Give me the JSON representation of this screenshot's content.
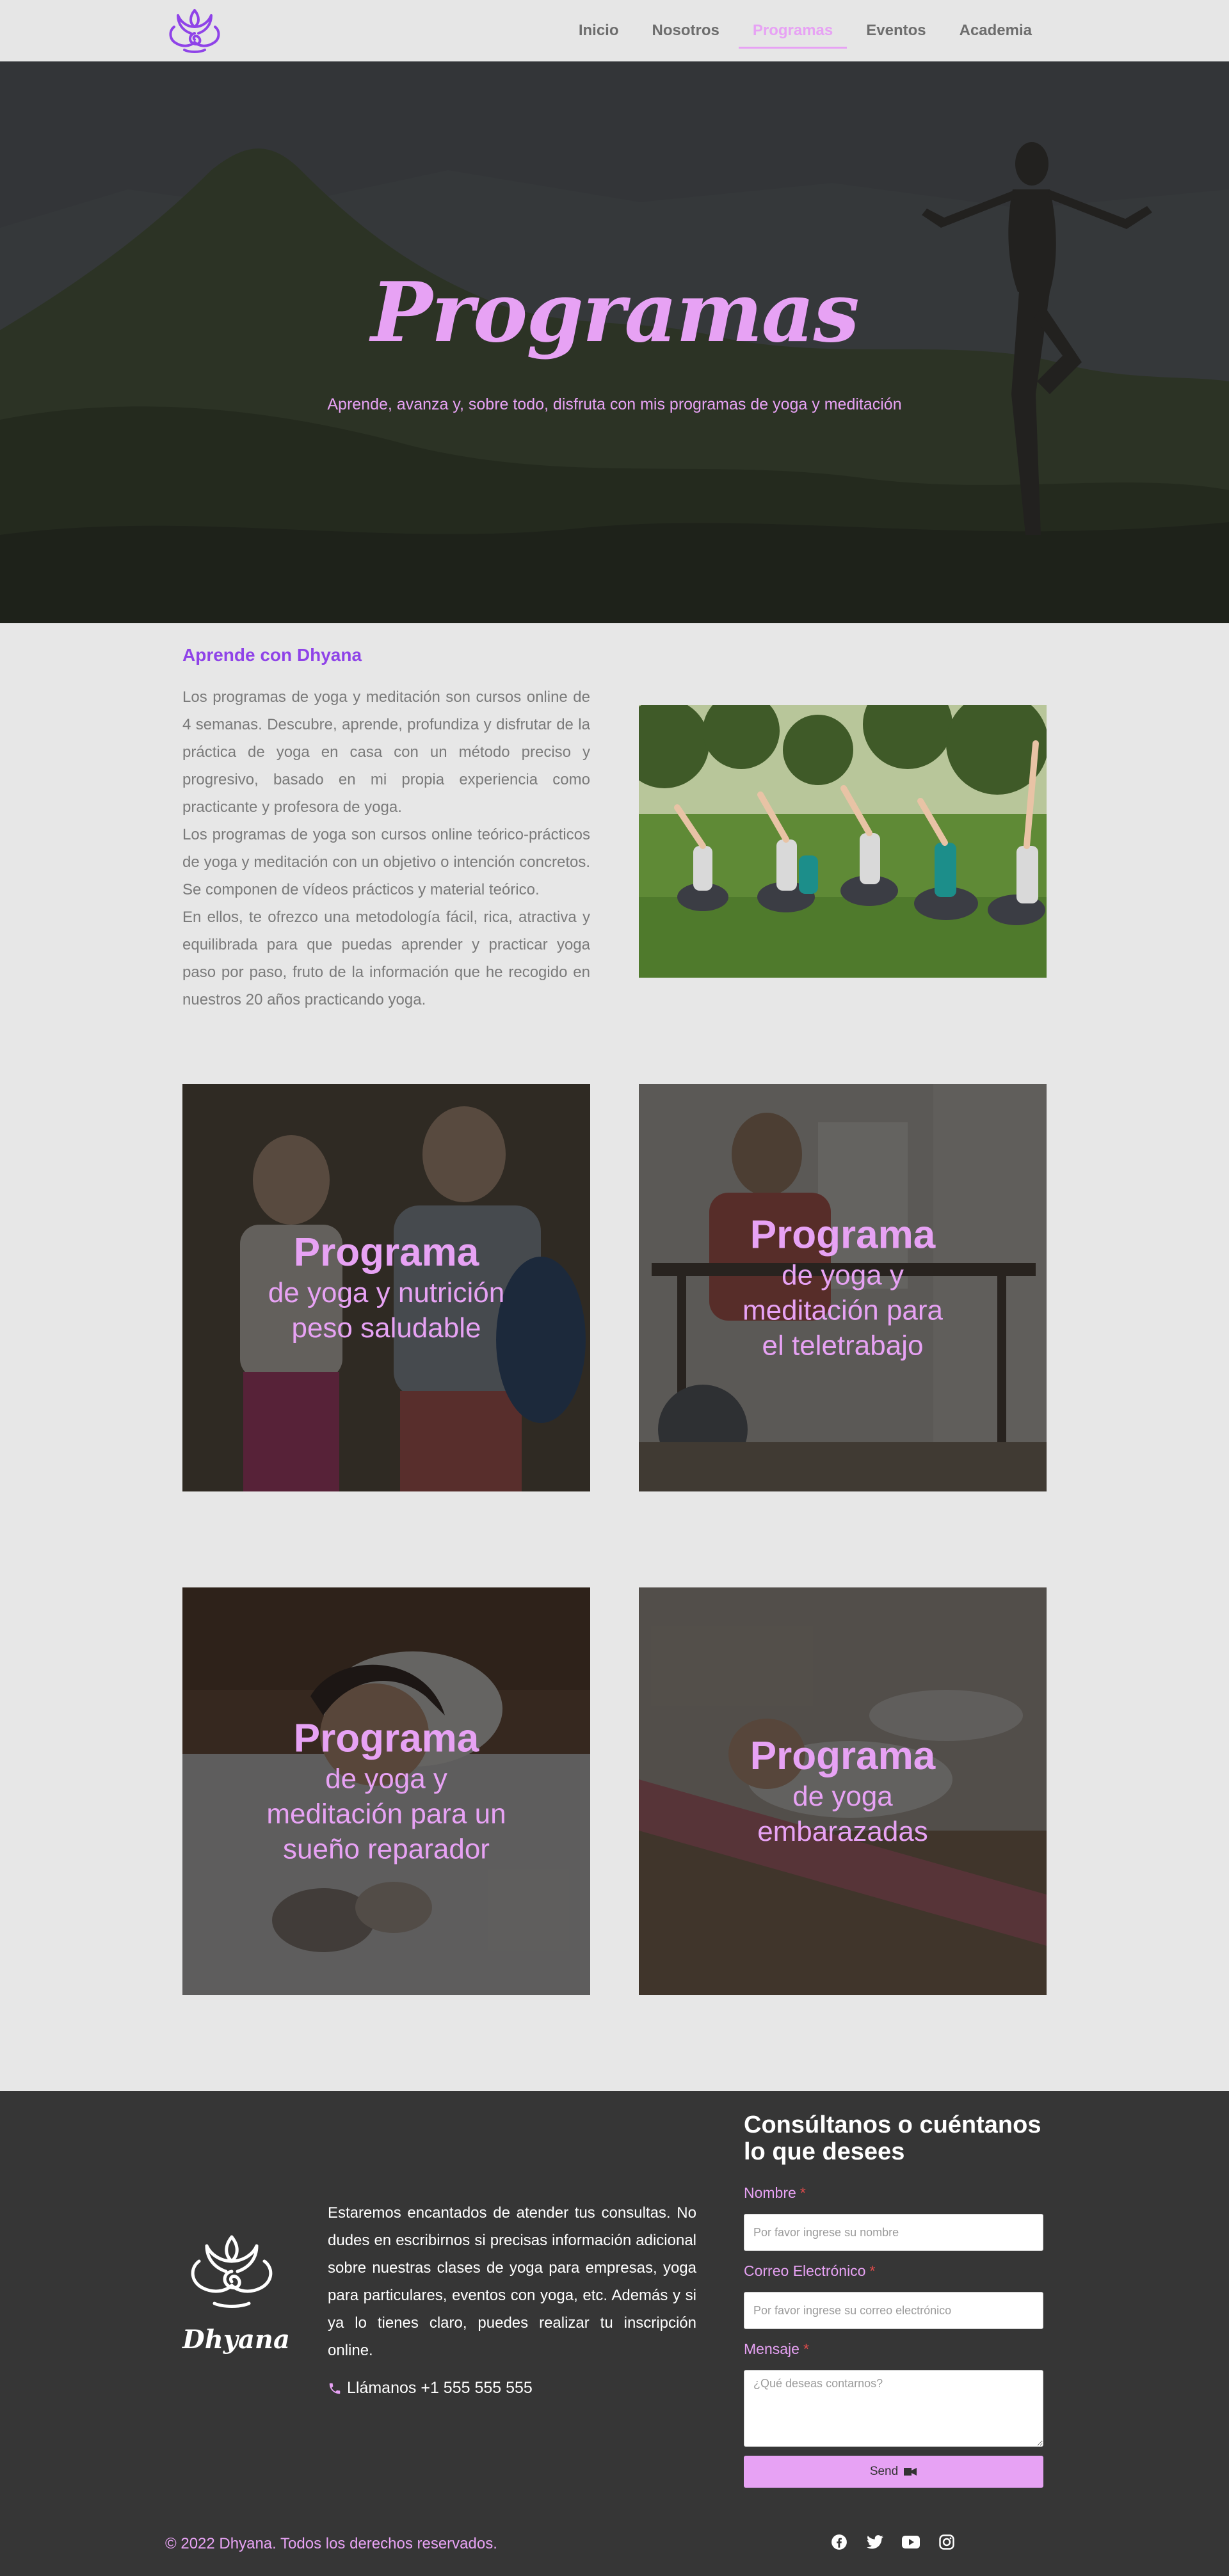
{
  "nav": {
    "items": [
      {
        "label": "Inicio",
        "active": false
      },
      {
        "label": "Nosotros",
        "active": false
      },
      {
        "label": "Programas",
        "active": true
      },
      {
        "label": "Eventos",
        "active": false
      },
      {
        "label": "Academia",
        "active": false
      }
    ]
  },
  "hero": {
    "title": "Programas",
    "subtitle": "Aprende, avanza y, sobre todo, disfruta con mis programas de yoga y meditación"
  },
  "intro": {
    "heading": "Aprende con Dhyana",
    "paragraphs": [
      "Los programas de yoga y meditación son cursos online de 4 semanas. Descubre, aprende, profundiza y disfrutar de la práctica de yoga en casa con un método preciso y progresivo, basado en mi propia experiencia como practicante y profesora de yoga.",
      "Los programas de yoga son cursos online teórico-prácticos de yoga y meditación con un objetivo o intención concretos. Se componen de vídeos prácticos y material teórico.",
      "En ellos, te ofrezco una metodología fácil, rica, atractiva y equilibrada para que puedas aprender y practicar yoga paso por paso, fruto de la información que he recogido en nuestros 20 años practicando yoga."
    ]
  },
  "programs": [
    {
      "title": "Programa",
      "subtitle": "de yoga y nutrición\npeso saludable"
    },
    {
      "title": "Programa",
      "subtitle": "de yoga y\nmeditación para\nel teletrabajo"
    },
    {
      "title": "Programa",
      "subtitle": "de yoga y\nmeditación para un\nsueño reparador"
    },
    {
      "title": "Programa",
      "subtitle": "de yoga\nembarazadas"
    }
  ],
  "footer": {
    "brand": "Dhyana",
    "text": "Estaremos encantados de atender tus consultas. No dudes en escribirnos si precisas información adicional sobre nuestras clases de yoga para empresas, yoga para particulares, eventos con yoga, etc. Además y si ya lo tienes claro, puedes realizar tu inscripción online.",
    "phone": "Llámanos +1 555 555 555",
    "copyright": "© 2022 Dhyana. Todos los derechos reservados.",
    "socials": [
      "facebook-icon",
      "twitter-icon",
      "youtube-icon",
      "instagram-icon"
    ]
  },
  "form": {
    "title": "Consúltanos o cuéntanos lo que desees",
    "name_label": "Nombre",
    "name_placeholder": "Por favor ingrese su nombre",
    "email_label": "Correo Electrónico",
    "email_placeholder": "Por favor ingrese su correo electrónico",
    "message_label": "Mensaje",
    "message_placeholder": "¿Qué deseas contarnos?",
    "required_mark": "*",
    "send_label": "Send"
  },
  "colors": {
    "accent": "#e7a2f4",
    "purple": "#8f43e8",
    "footer_bg": "#363636",
    "page_bg": "#e7e7e7"
  }
}
